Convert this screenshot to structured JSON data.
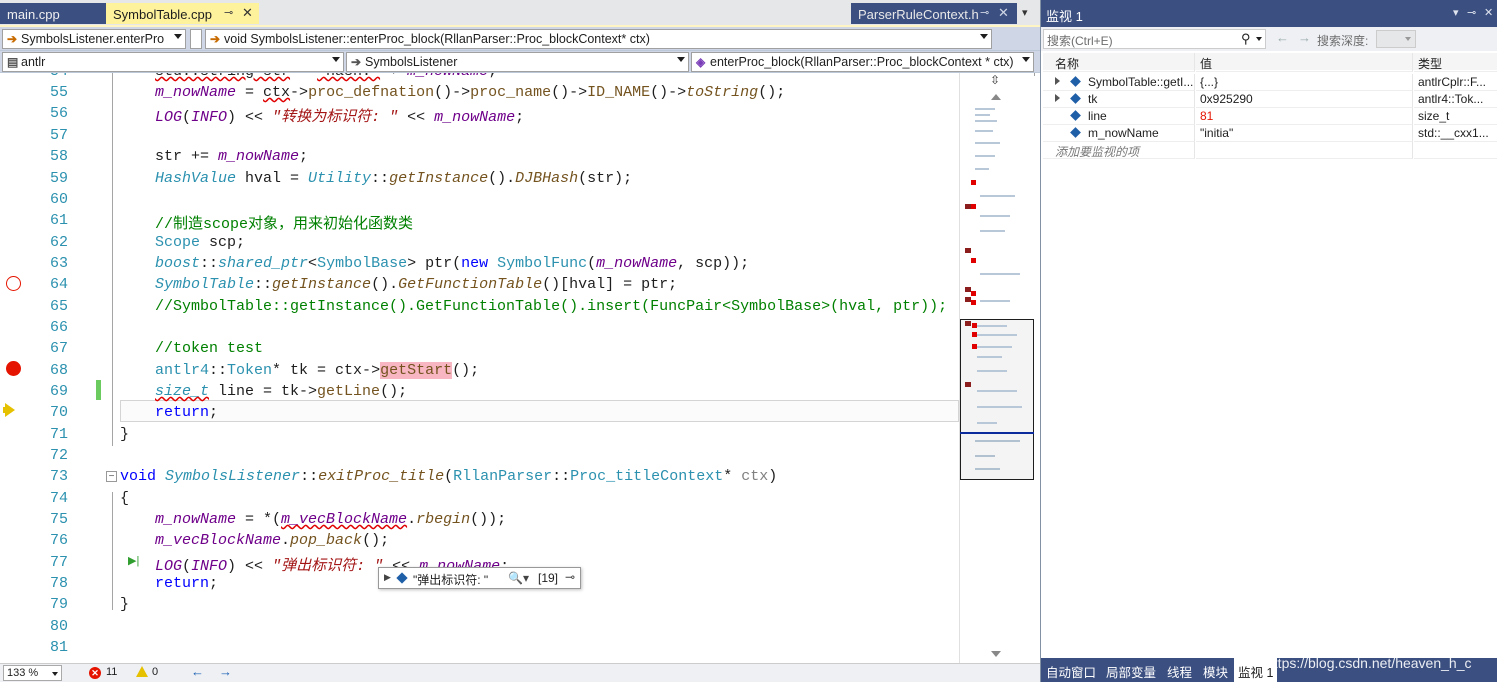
{
  "tabs": {
    "main": "main.cpp",
    "active": "SymbolTable.cpp",
    "parser": "ParserRuleContext.h"
  },
  "nav": {
    "scope_combo": "SymbolsListener.enterPro",
    "function_combo": "void SymbolsListener::enterProc_block(RllanParser::Proc_blockContext* ctx)",
    "go_label": "Go",
    "project_combo": "antlr",
    "class_combo": "SymbolsListener",
    "member_combo": "enterProc_block(RllanParser::Proc_blockContext * ctx)"
  },
  "code": {
    "line_numbers": [
      "54",
      "55",
      "56",
      "57",
      "58",
      "59",
      "60",
      "61",
      "62",
      "63",
      "64",
      "65",
      "66",
      "67",
      "68",
      "69",
      "70",
      "71",
      "72",
      "73",
      "74",
      "75",
      "76",
      "77",
      "78",
      "79",
      "80",
      "81"
    ]
  },
  "datatip": {
    "value": "\"弹出标识符: \"",
    "count": "[19]"
  },
  "status": {
    "zoom": "133 %",
    "errors": "11",
    "warnings": "0"
  },
  "watch": {
    "title": "监视 1",
    "search_placeholder": "搜索(Ctrl+E)",
    "depth_label": "搜索深度:",
    "columns": [
      "名称",
      "值",
      "类型"
    ],
    "rows": [
      {
        "name": "SymbolTable::getI...",
        "value": "{...}",
        "type": "antlrCplr::F..."
      },
      {
        "name": "tk",
        "value": "0x925290",
        "type": "antlr4::Tok..."
      },
      {
        "name": "line",
        "value": "81",
        "type": "size_t"
      },
      {
        "name": "m_nowName",
        "value": "\"initia\"",
        "type": "std::__cxx1..."
      }
    ],
    "add_item": "添加要监视的项",
    "bottom_tabs": [
      "自动窗口",
      "局部变量",
      "线程",
      "模块",
      "监视 1"
    ]
  },
  "watermark": "https://blog.csdn.net/heaven_h_c",
  "colors": {
    "title_bar": "#3b4f81",
    "active_tab": "#fff29d",
    "breakpoint": "#e51400",
    "line_number": "#2b91af",
    "keyword": "#0000ff",
    "comment": "#008000"
  }
}
